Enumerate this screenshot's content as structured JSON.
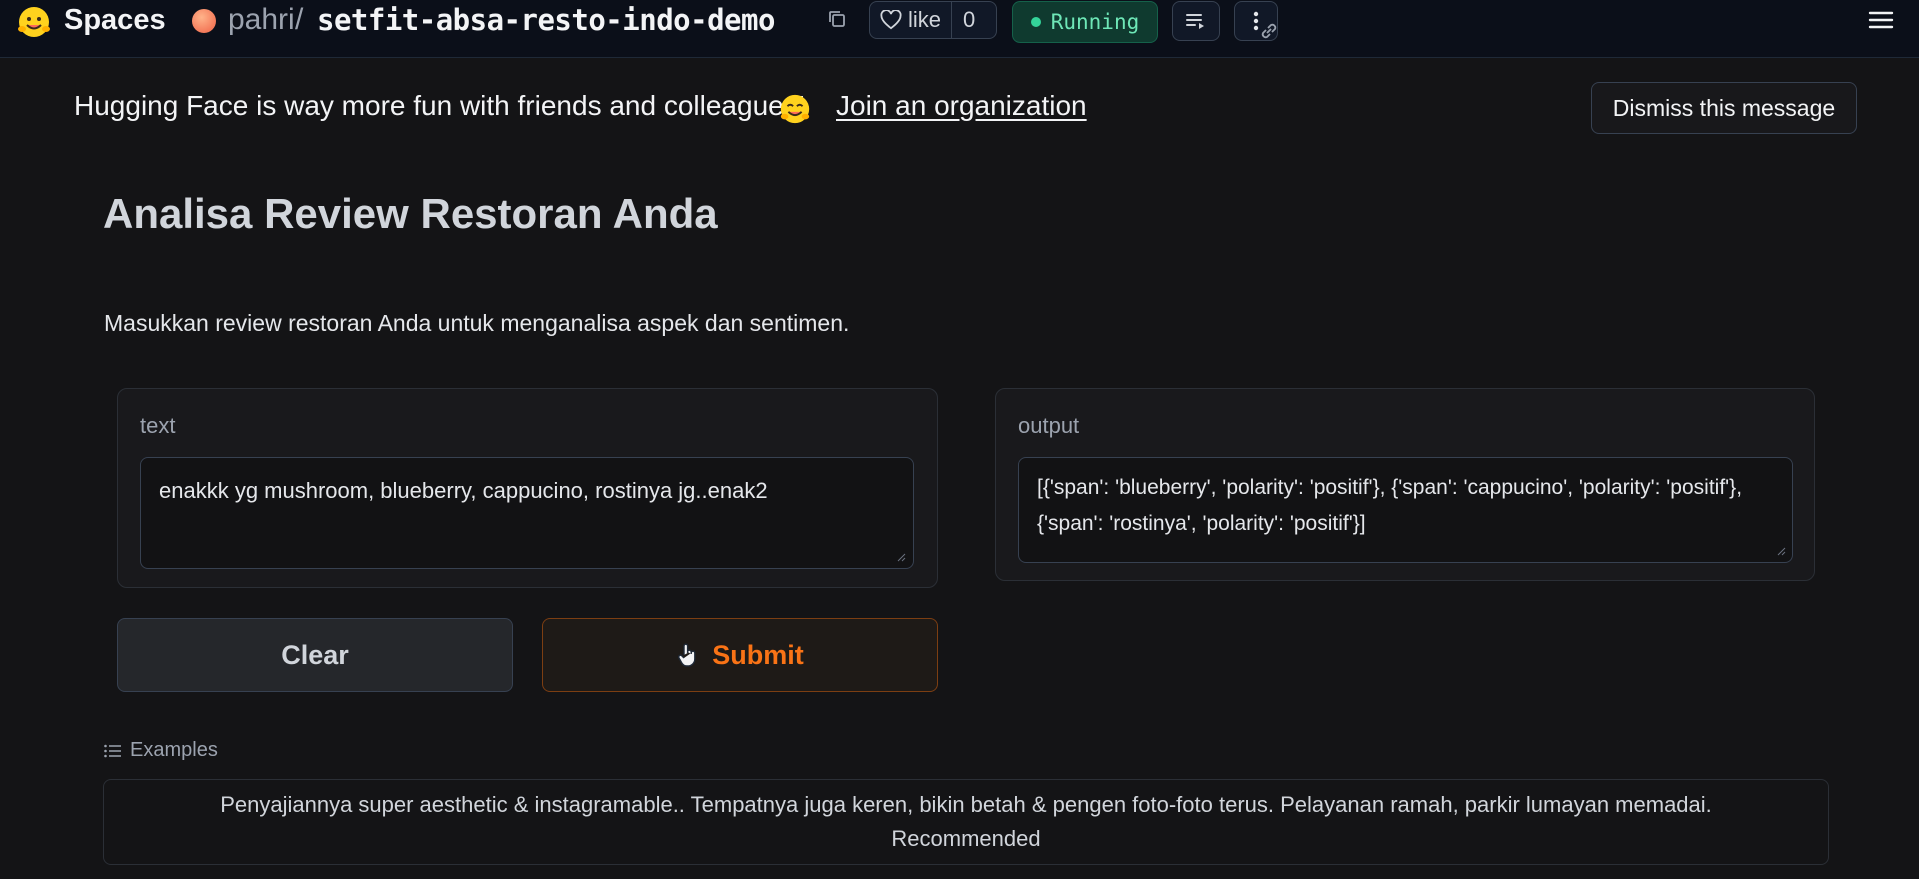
{
  "nav": {
    "logo_icon": "hugging-face-emoji-icon",
    "spaces_label": "Spaces",
    "owner": "pahri",
    "separator": "/",
    "repo_name": "setfit-absa-resto-indo-demo",
    "like_label": "like",
    "like_count": "0",
    "status": "Running",
    "colors": {
      "status_text": "#6ee7b7",
      "status_bg": "#0f3a2f",
      "accent": "#f97316"
    }
  },
  "banner": {
    "message": "Hugging Face is way more fun with friends and colleagues!",
    "link_text": "Join an organization",
    "dismiss_label": "Dismiss this message"
  },
  "app": {
    "title": "Analisa Review Restoran Anda",
    "description": "Masukkan review restoran Anda untuk menganalisa aspek dan sentimen.",
    "input": {
      "label": "text",
      "value": "enakkk yg mushroom, blueberry, cappucino, rostinya jg..enak2"
    },
    "output": {
      "label": "output",
      "value": "[{'span': 'blueberry', 'polarity': 'positif'}, {'span': 'cappucino', 'polarity': 'positif'}, {'span': 'rostinya', 'polarity': 'positif'}]"
    },
    "buttons": {
      "clear": "Clear",
      "submit": "Submit"
    },
    "examples": {
      "label": "Examples",
      "items": [
        "Penyajiannya super aesthetic & instagramable.. Tempatnya juga keren, bikin betah & pengen foto-foto terus. Pelayanan ramah, parkir lumayan memadai. Recommended"
      ]
    }
  }
}
